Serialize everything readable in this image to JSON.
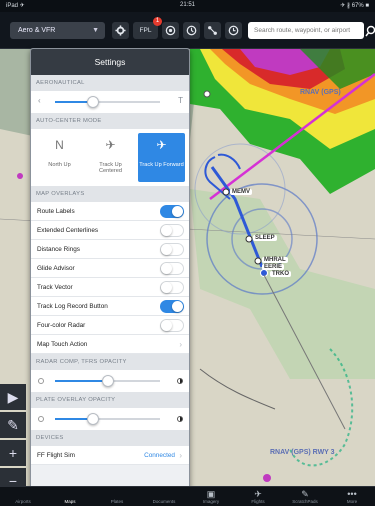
{
  "status": {
    "carrier": "iPad ✈",
    "time": "21:51",
    "battery": "✈ ∦ 67% ■"
  },
  "toolbar": {
    "layer": "Aero & VFR",
    "fpl": "FPL",
    "fpl_badge": "1",
    "search_placeholder": "Search route, waypoint, or airport"
  },
  "settings": {
    "title": "Settings",
    "aeronautical_header": "AERONAUTICAL",
    "aeronautical_slider": {
      "right": "T",
      "value": 0.36
    },
    "autocenter_header": "AUTO-CENTER MODE",
    "autocenter_options": [
      {
        "label": "North Up",
        "glyph": "N",
        "active": false
      },
      {
        "label": "Track Up Centered",
        "glyph": "✈",
        "active": false
      },
      {
        "label": "Track Up Forward",
        "glyph": "✈",
        "active": true
      }
    ],
    "overlays_header": "MAP OVERLAYS",
    "overlays": [
      {
        "label": "Route Labels",
        "on": true
      },
      {
        "label": "Extended Centerlines",
        "on": false
      },
      {
        "label": "Distance Rings",
        "on": false
      },
      {
        "label": "Glide Advisor",
        "on": false
      },
      {
        "label": "Track Vector",
        "on": false
      },
      {
        "label": "Track Log Record Button",
        "on": true
      },
      {
        "label": "Four-color Radar",
        "on": false
      }
    ],
    "touch_action": "Map Touch Action",
    "radar_header": "RADAR COMP, TFRS OPACITY",
    "radar_slider": {
      "value": 0.5
    },
    "plate_header": "PLATE OVERLAY OPACITY",
    "plate_slider": {
      "value": 0.36
    },
    "devices_header": "DEVICES",
    "device_name": "FF Flight Sim",
    "device_status": "Connected"
  },
  "map": {
    "labels": [
      "MEMV",
      "SLEEP",
      "MHRAL",
      "EERIE",
      "TRKO"
    ],
    "rnav_top": "RNAV (GPS)",
    "rnav_bottom": "RNAV (GPS) RWY 3"
  },
  "tabs": [
    {
      "label": "Airports",
      "icon": "airport-icon",
      "glyph": ""
    },
    {
      "label": "Maps",
      "icon": "map-icon",
      "glyph": ""
    },
    {
      "label": "Plates",
      "icon": "plate-icon",
      "glyph": ""
    },
    {
      "label": "Documents",
      "icon": "document-icon",
      "glyph": ""
    },
    {
      "label": "Imagery",
      "icon": "imagery-icon",
      "glyph": "▣"
    },
    {
      "label": "Flights",
      "icon": "plane-icon",
      "glyph": "✈"
    },
    {
      "label": "ScratchPads",
      "icon": "pen-icon",
      "glyph": "✎"
    },
    {
      "label": "More",
      "icon": "more-icon",
      "glyph": "•••"
    }
  ],
  "colors": {
    "accent": "#2f88e4",
    "route": "#d531d5",
    "panel_header": "#353b43"
  }
}
